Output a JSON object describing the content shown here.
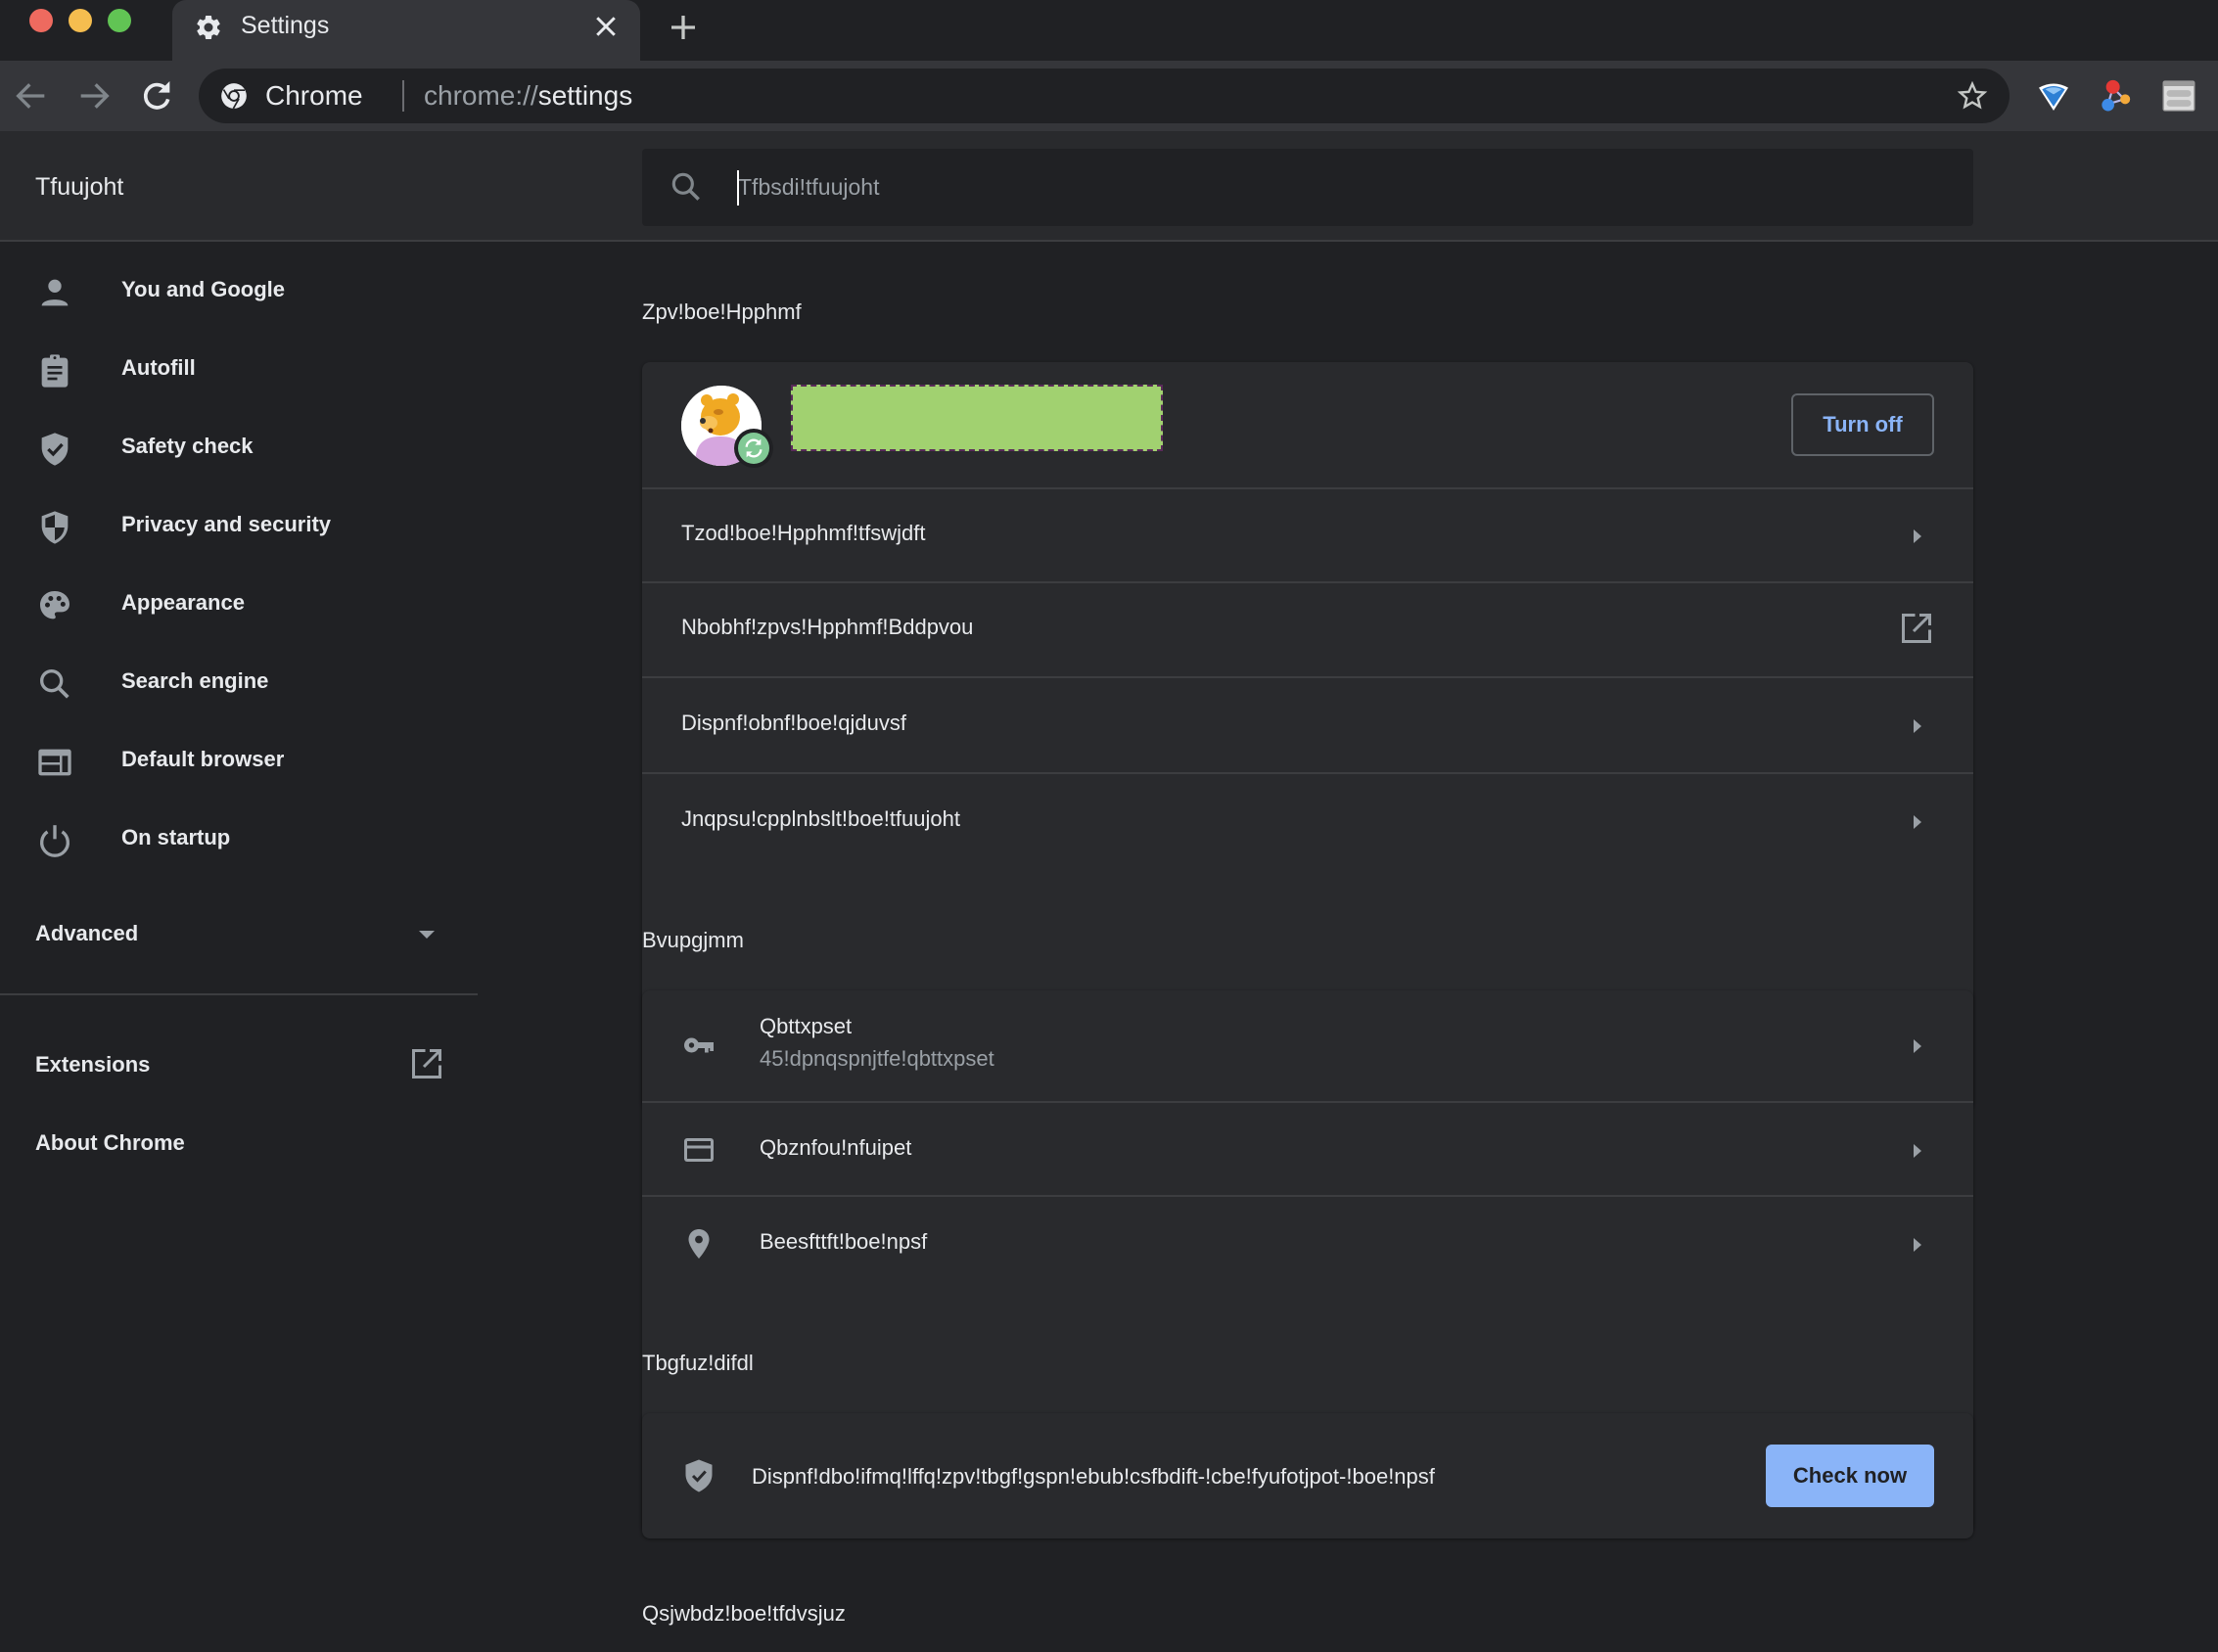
{
  "window": {
    "tab": {
      "title": "Settings",
      "icon": "gear-icon",
      "close": "×"
    },
    "new_tab_label": "+"
  },
  "toolbar": {
    "omnibox": {
      "site_label": "Chrome",
      "url_scheme": "chrome://",
      "url_host": "settings"
    },
    "extensions": [
      "diamond-extension-icon",
      "molecule-extension-icon",
      "window-extension-icon"
    ]
  },
  "header": {
    "title": "Tfuujoht",
    "search": {
      "placeholder": "Tfbsdi!tfuujoht",
      "value": ""
    }
  },
  "sidebar": {
    "items": [
      {
        "label": "You and Google",
        "icon": "person-icon"
      },
      {
        "label": "Autofill",
        "icon": "clipboard-icon"
      },
      {
        "label": "Safety check",
        "icon": "shield-check-icon"
      },
      {
        "label": "Privacy and security",
        "icon": "shield-half-icon"
      },
      {
        "label": "Appearance",
        "icon": "palette-icon"
      },
      {
        "label": "Search engine",
        "icon": "search-icon"
      },
      {
        "label": "Default browser",
        "icon": "browser-icon"
      },
      {
        "label": "On startup",
        "icon": "power-icon"
      }
    ],
    "advanced": {
      "label": "Advanced"
    },
    "extensions": {
      "label": "Extensions"
    },
    "about": {
      "label": "About Chrome"
    }
  },
  "main": {
    "you_and_google": {
      "heading": "Zpv!boe!Hpphmf",
      "turn_off_label": "Turn off",
      "rows": [
        {
          "label": "Tzod!boe!Hpphmf!tfswjdft",
          "trailing": "arrow"
        },
        {
          "label": "Nbobhf!zpvs!Hpphmf!Bddpvou",
          "trailing": "external-link"
        },
        {
          "label": "Dispnf!obnf!boe!qjduvsf",
          "trailing": "arrow"
        },
        {
          "label": "Jnqpsu!cpplnbslt!boe!tfuujoht",
          "trailing": "arrow"
        }
      ]
    },
    "autofill": {
      "heading": "Bvupgjmm",
      "rows": [
        {
          "label": "Qbttxpset",
          "sublabel": "45!dpnqspnjtfe!qbttxpset",
          "icon": "key-icon"
        },
        {
          "label": "Qbznfou!nfuipet",
          "icon": "credit-card-icon"
        },
        {
          "label": "Beesfttft!boe!npsf",
          "icon": "location-pin-icon"
        }
      ]
    },
    "safety_check": {
      "heading": "Tbgfuz!difdl",
      "text": "Dispnf!dbo!ifmq!lffq!zpv!tbgf!gspn!ebub!csfbdift-!cbe!fyufotjpot-!boe!npsf",
      "button_label": "Check now"
    },
    "privacy": {
      "heading": "Qsjwbdz!boe!tfdvsjuz"
    }
  },
  "colors": {
    "accent": "#8ab4f8",
    "background": "#202124",
    "card": "#292a2d",
    "sync_badge": "#81c995",
    "redaction": "#a1d170"
  }
}
